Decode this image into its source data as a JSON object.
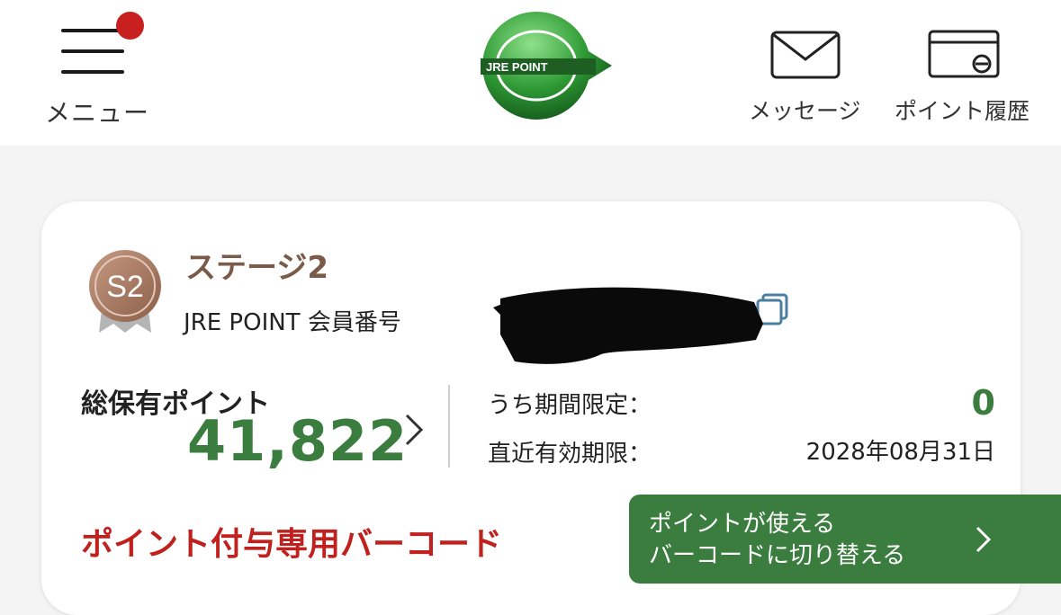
{
  "header": {
    "menu_label": "メニュー",
    "logo_text": "JRE POINT",
    "message_label": "メッセージ",
    "history_label": "ポイント履歴"
  },
  "card": {
    "stage_badge": "S2",
    "stage_label": "ステージ2",
    "member_label": "JRE POINT 会員番号",
    "total_label": "総保有ポイント",
    "total_points": "41,822",
    "limited_label": "うち期間限定：",
    "limited_value": "0",
    "expiry_label": "直近有効期限：",
    "expiry_value": "2028年08月31日",
    "barcode_title": "ポイント付与専用バーコード",
    "switch_line1": "ポイントが使える",
    "switch_line2": "バーコードに切り替える"
  },
  "colors": {
    "brand_green": "#3b7d3f",
    "accent_red": "#c0211e",
    "stage_brown": "#7a5a48",
    "notification_dot": "#c8201e"
  },
  "icons": {
    "menu": "hamburger-icon",
    "message": "envelope-icon",
    "history": "card-history-icon",
    "copy": "copy-icon",
    "chevron": "chevron-right-icon"
  }
}
